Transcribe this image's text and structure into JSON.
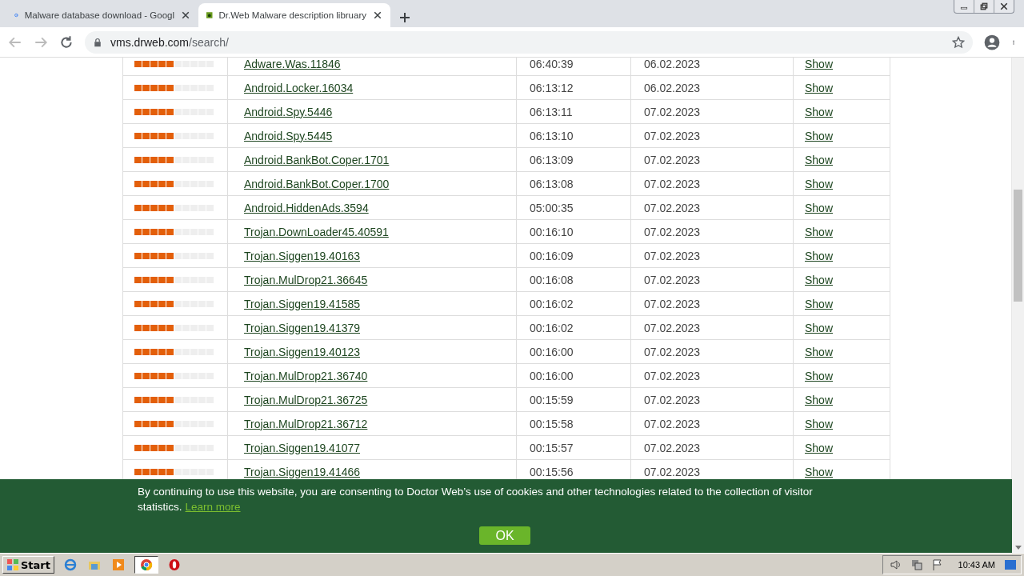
{
  "browser": {
    "tabs": [
      {
        "title": "Malware database download - Googl",
        "selected": false
      },
      {
        "title": "Dr.Web Malware description libruary",
        "selected": true
      }
    ],
    "url_host": "vms.drweb.com",
    "url_path": "/search/"
  },
  "table": {
    "rows": [
      {
        "stars": 5,
        "name": "Adware.Was.11846",
        "time": "06:40:39",
        "date": "06.02.2023",
        "action": "Show"
      },
      {
        "stars": 5,
        "name": "Android.Locker.16034",
        "time": "06:13:12",
        "date": "06.02.2023",
        "action": "Show"
      },
      {
        "stars": 5,
        "name": "Android.Spy.5446",
        "time": "06:13:11",
        "date": "07.02.2023",
        "action": "Show"
      },
      {
        "stars": 5,
        "name": "Android.Spy.5445",
        "time": "06:13:10",
        "date": "07.02.2023",
        "action": "Show"
      },
      {
        "stars": 5,
        "name": "Android.BankBot.Coper.1701",
        "time": "06:13:09",
        "date": "07.02.2023",
        "action": "Show"
      },
      {
        "stars": 5,
        "name": "Android.BankBot.Coper.1700",
        "time": "06:13:08",
        "date": "07.02.2023",
        "action": "Show"
      },
      {
        "stars": 5,
        "name": "Android.HiddenAds.3594",
        "time": "05:00:35",
        "date": "07.02.2023",
        "action": "Show"
      },
      {
        "stars": 5,
        "name": "Trojan.DownLoader45.40591",
        "time": "00:16:10",
        "date": "07.02.2023",
        "action": "Show"
      },
      {
        "stars": 5,
        "name": "Trojan.Siggen19.40163",
        "time": "00:16:09",
        "date": "07.02.2023",
        "action": "Show"
      },
      {
        "stars": 5,
        "name": "Trojan.MulDrop21.36645",
        "time": "00:16:08",
        "date": "07.02.2023",
        "action": "Show"
      },
      {
        "stars": 5,
        "name": "Trojan.Siggen19.41585",
        "time": "00:16:02",
        "date": "07.02.2023",
        "action": "Show"
      },
      {
        "stars": 5,
        "name": "Trojan.Siggen19.41379",
        "time": "00:16:02",
        "date": "07.02.2023",
        "action": "Show"
      },
      {
        "stars": 5,
        "name": "Trojan.Siggen19.40123",
        "time": "00:16:00",
        "date": "07.02.2023",
        "action": "Show"
      },
      {
        "stars": 5,
        "name": "Trojan.MulDrop21.36740",
        "time": "00:16:00",
        "date": "07.02.2023",
        "action": "Show"
      },
      {
        "stars": 5,
        "name": "Trojan.MulDrop21.36725",
        "time": "00:15:59",
        "date": "07.02.2023",
        "action": "Show"
      },
      {
        "stars": 5,
        "name": "Trojan.MulDrop21.36712",
        "time": "00:15:58",
        "date": "07.02.2023",
        "action": "Show"
      },
      {
        "stars": 5,
        "name": "Trojan.Siggen19.41077",
        "time": "00:15:57",
        "date": "07.02.2023",
        "action": "Show"
      },
      {
        "stars": 5,
        "name": "Trojan.Siggen19.41466",
        "time": "00:15:56",
        "date": "07.02.2023",
        "action": "Show"
      }
    ]
  },
  "cookie_banner": {
    "text": "By continuing to use this website, you are consenting to Doctor Web’s use of cookies and other technologies related to the collection of visitor statistics.",
    "link": "Learn more",
    "button": "OK"
  },
  "taskbar": {
    "start": "Start",
    "clock": "10:43 AM"
  }
}
